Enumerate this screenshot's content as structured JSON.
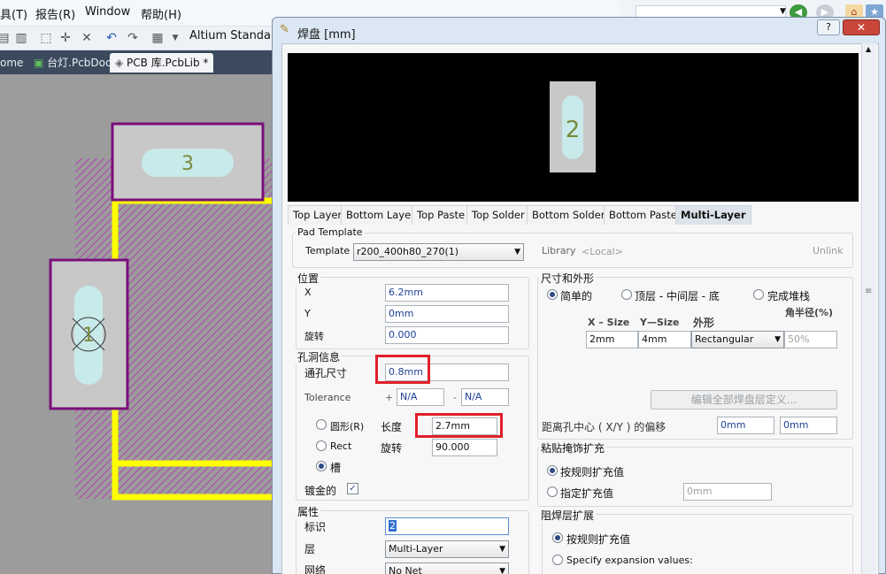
{
  "menu": {
    "items": [
      "具(T)",
      "报告(R)",
      "Window",
      "帮助(H)"
    ]
  },
  "toolbar": {
    "standard_label": "Altium Standard"
  },
  "tabs": [
    {
      "label": "ome"
    },
    {
      "label": "台灯.PcbDoc"
    },
    {
      "label": "PCB 库.PcbLib *"
    }
  ],
  "canvas": {
    "pads": [
      {
        "designator": "3"
      },
      {
        "designator": "1"
      }
    ],
    "colors": {
      "background": "#9c9c9c",
      "pad": "#c8c8c8",
      "outline": "#7a0f7a",
      "hole": "#c8eaea",
      "track": "#ffff00",
      "hatch": "#b040b0"
    }
  },
  "dialog": {
    "title": "焊盘 [mm]",
    "help_label": "?",
    "close_label": "✕",
    "preview": {
      "designator": "2"
    },
    "layer_tabs": [
      "Top Layer",
      "Bottom Layer",
      "Top Paste",
      "Top Solder",
      "Bottom Solder",
      "Bottom Paste",
      "Multi-Layer"
    ],
    "active_layer_tab": "Multi-Layer",
    "pad_template": {
      "group_label": "Pad Template",
      "template_label": "Template",
      "template_value": "r200_400h80_270(1)",
      "library_label": "Library",
      "library_value": "<Local>",
      "unlink_label": "Unlink"
    },
    "location": {
      "group_label": "位置",
      "x_label": "X",
      "x_value": "6.2mm",
      "y_label": "Y",
      "y_value": "0mm",
      "rotation_label": "旋转",
      "rotation_value": "0.000"
    },
    "hole": {
      "group_label": "孔洞信息",
      "size_label": "通孔尺寸",
      "size_value": "0.8mm",
      "tolerance_label": "Tolerance",
      "plus_sign": "+",
      "plus_value": "N/A",
      "minus_sign": "-",
      "minus_value": "N/A",
      "round_label": "圆形(R)",
      "rect_label": "Rect",
      "slot_label": "槽",
      "selected_shape": "槽",
      "length_label": "长度",
      "length_value": "2.7mm",
      "rotation_label": "旋转",
      "rotation_value": "90.000",
      "plated_label": "镀金的",
      "plated_checked": true,
      "plated_mark": "✓"
    },
    "properties": {
      "group_label": "属性",
      "designator_label": "标识",
      "designator_value": "2",
      "layer_label": "层",
      "layer_value": "Multi-Layer",
      "net_label": "网络",
      "net_value": "No Net"
    },
    "size_shape": {
      "group_label": "尺寸和外形",
      "simple_label": "简单的",
      "top_mid_bottom_label": "顶层 - 中间层 - 底",
      "full_stack_label": "完成堆栈",
      "selected": "简单的",
      "corner_radius_label": "角半径(%)",
      "xsize_header": "X – Size",
      "ysize_header": "Y—Size",
      "shape_header": "外形",
      "xsize_value": "2mm",
      "ysize_value": "4mm",
      "shape_value": "Rectangular",
      "corner_value": "50%",
      "edit_all_button": "编辑全部焊盘层定义...",
      "offset_label": "距离孔中心 ( X/Y ) 的偏移",
      "offset_x": "0mm",
      "offset_y": "0mm"
    },
    "paste_mask": {
      "group_label": "粘贴掩饰扩充",
      "rule_label": "按规则扩充值",
      "specified_label": "指定扩充值",
      "specified_value": "0mm",
      "selected": "按规则扩充值"
    },
    "solder_mask": {
      "group_label": "阻焊层扩展",
      "rule_label": "按规则扩充值",
      "specify_label": "Specify expansion values:",
      "selected": "按规则扩充值"
    }
  }
}
